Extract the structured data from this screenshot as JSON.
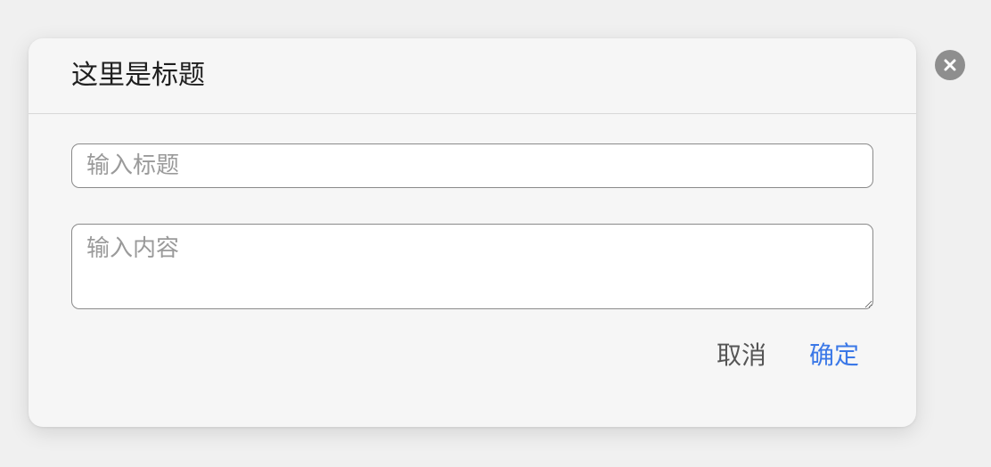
{
  "dialog": {
    "title": "这里是标题",
    "title_input": {
      "value": "",
      "placeholder": "输入标题"
    },
    "content_input": {
      "value": "",
      "placeholder": "输入内容"
    },
    "cancel_label": "取消",
    "confirm_label": "确定"
  },
  "colors": {
    "confirm": "#3b78e7",
    "cancel": "#555555",
    "close_button": "#8e8e8e",
    "dialog_background": "#f6f6f6",
    "page_background": "#f0f0f0"
  },
  "icons": {
    "close": "close-icon"
  }
}
